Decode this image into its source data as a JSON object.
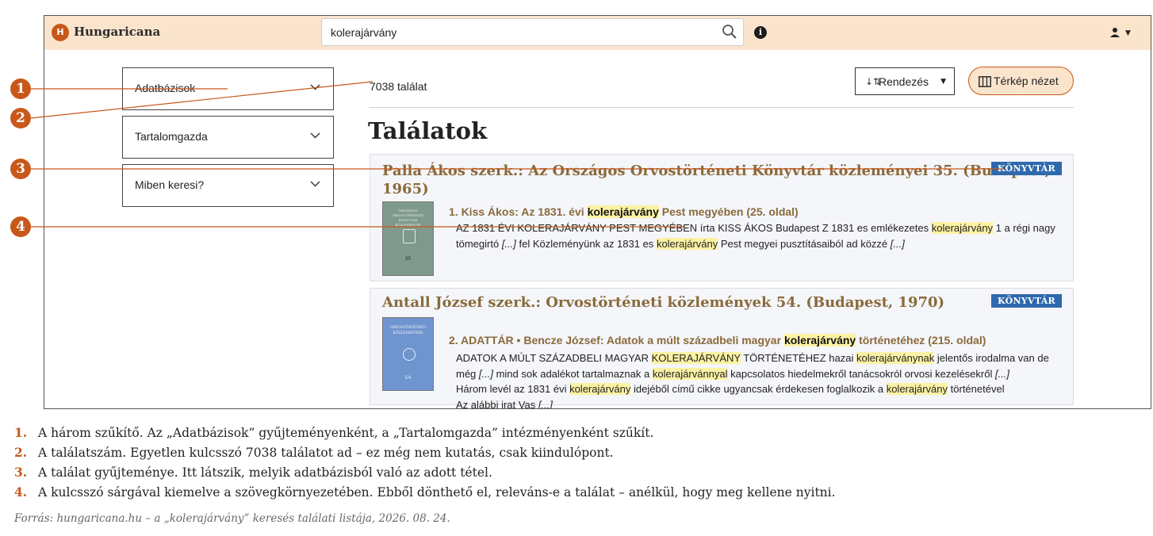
{
  "app": {
    "name": "Hungaricana",
    "logo_glyph": "H"
  },
  "search": {
    "value": "kolerajárvány"
  },
  "filters": [
    {
      "label": "Adatbázisok"
    },
    {
      "label": "Tartalomgazda"
    },
    {
      "label": "Miben keresi?"
    }
  ],
  "results": {
    "count_text": "7038 találat",
    "sort_label": "Rendezés",
    "map_label": "Térkép nézet",
    "heading": "Találatok",
    "items": [
      {
        "title_line1": "Palla Ákos szerk.: Az Országos Orvostörténeti Könyvtár közleményei 35. (Budapest,",
        "title_line2": "1965)",
        "badge": "KÖNYVTÁR",
        "hit_pre": "1. Kiss Ákos: Az 1831. évi ",
        "hit_kw": "kolerajárvány",
        "hit_post": " Pest megyében (25. oldal)",
        "s1_a": "AZ 1831 ÉVI ",
        "s1_kw1": "KOLERAJÁRVÁNY",
        "s1_b": " PEST MEGYÉBEN írta KISS ÁKOS Budapest Z 1831 es emlékezetes ",
        "s1_kw2": "kolerajárvány",
        "s1_c": " 1 a régi nagy",
        "s2_a": "tömegirtó ",
        "s2_e1": "[...]",
        "s2_b": " fel Közleményünk az 1831 es ",
        "s2_kw": "kolerajárvány",
        "s2_c": " Pest megyei pusztításaiból ad közzé ",
        "s2_e2": "[...]"
      },
      {
        "title_line1": "Antall József szerk.: Orvostörténeti közlemények 54. (Budapest, 1970)",
        "badge": "KÖNYVTÁR",
        "hit_pre": "2. ADATTÁR • Bencze József: Adatok a múlt századbeli magyar ",
        "hit_kw": "kolerajárvány",
        "hit_post": " történetéhez (215. oldal)",
        "s1_a": "ADATOK A MÚLT SZÁZADBELI MAGYAR ",
        "s1_kw1": "KOLERAJÁRVÁNY",
        "s1_b": " TÖRTÉNETÉHEZ hazai ",
        "s1_kw2": "kolerajárványnak",
        "s1_c": " jelentős irodalma van de",
        "s2_a": "még ",
        "s2_e1": "[...]",
        "s2_b": " mind sok adalékot tartalmaznak a ",
        "s2_kw": "kolerajárvánnyal",
        "s2_c": " kapcsolatos hiedelmekről tanácsokról orvosi kezelésekről ",
        "s2_e2": "[...]",
        "s3_a": "Három levél az 1831 évi ",
        "s3_kw1": "kolerajárvány",
        "s3_b": " idejéből című cikke ugyancsak érdekesen foglalkozik a ",
        "s3_kw2": "kolerajárvány",
        "s3_c": " történetével",
        "s4_a": "Az alábbi irat Vas ",
        "s4_e": "[...]"
      }
    ]
  },
  "thumbs": [
    {
      "lines": [
        "ORSZÁGOS ORVOSTÖRTÉNETI",
        "KÖNYVTÁR",
        "KÖZLEMÉNYEI"
      ],
      "number": "35"
    },
    {
      "lines": [
        "ORVOSTÖRTÉNETI",
        "KÖZLEMÉNYEK"
      ],
      "number": "54"
    }
  ],
  "markers": [
    "1",
    "2",
    "3",
    "4"
  ],
  "captions": [
    {
      "num": "1.",
      "text": "A három szűkítő. Az „Adatbázisok” gyűjteményenként, a „Tartalomgazda” intézményenként szűkít."
    },
    {
      "num": "2.",
      "text": "A találatszám. Egyetlen kulcsszó 7038 találatot ad – ez még nem kutatás, csak kiindulópont."
    },
    {
      "num": "3.",
      "text": "A találat gyűjteménye. Itt látszik, melyik adatbázisból való az adott tétel."
    },
    {
      "num": "4.",
      "text": "A kulcsszó sárgával kiemelve a szövegkörnyezetében. Ebből dönthető el, releváns-e a találat – anélkül, hogy meg kellene nyitni."
    }
  ],
  "source": "Forrás: hungaricana.hu – a „kolerajárvány” keresés találati listája, 2026. 08. 24.",
  "colors": {
    "accent": "#c8581a",
    "topbar": "#fbe4cc",
    "badge": "#2f69ad",
    "highlight": "#fbf2a4",
    "title": "#8a6a3c"
  }
}
